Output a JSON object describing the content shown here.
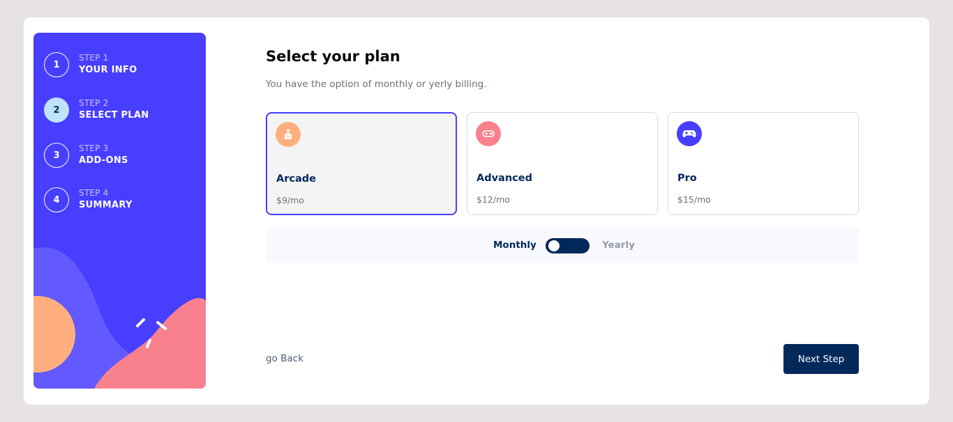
{
  "sidebar": {
    "steps": [
      {
        "number": "1",
        "label": "STEP 1",
        "title": "YOUR INFO"
      },
      {
        "number": "2",
        "label": "STEP 2",
        "title": "SELECT PLAN"
      },
      {
        "number": "3",
        "label": "STEP 3",
        "title": "ADD-ONS"
      },
      {
        "number": "4",
        "label": "STEP 4",
        "title": "SUMMARY"
      }
    ],
    "active_step": 2
  },
  "main": {
    "title": "Select your plan",
    "subtitle": "You have the option of monthly or yerly billing.",
    "plans": [
      {
        "name": "Arcade",
        "price": "$9/mo",
        "icon": "arcade-icon",
        "color": "#ffaf7e",
        "selected": true
      },
      {
        "name": "Advanced",
        "price": "$12/mo",
        "icon": "gamepad-icon",
        "color": "#f9818e",
        "selected": false
      },
      {
        "name": "Pro",
        "price": "$15/mo",
        "icon": "controller-icon",
        "color": "#483eff",
        "selected": false
      }
    ],
    "billing": {
      "monthly_label": "Monthly",
      "yearly_label": "Yearly",
      "mode": "Monthly"
    }
  },
  "footer": {
    "back_label": "go Back",
    "next_label": "Next Step"
  },
  "colors": {
    "accent": "#483eff",
    "navy": "#02295a",
    "active_step": "#bfe2fd"
  }
}
